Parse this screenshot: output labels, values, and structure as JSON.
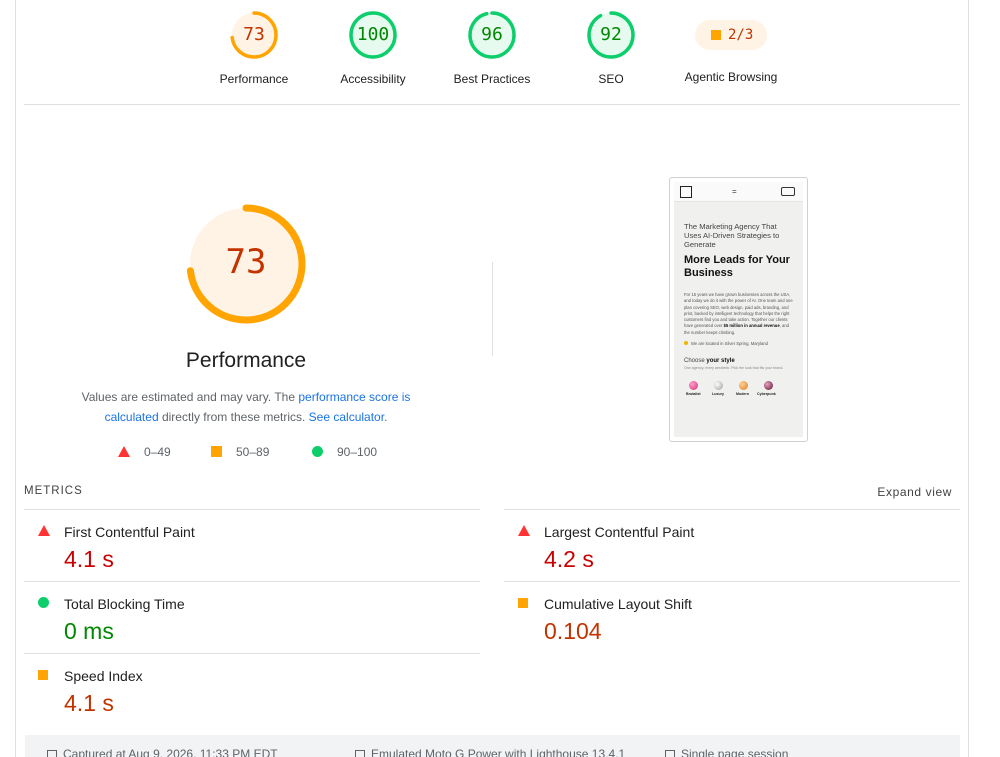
{
  "categories": [
    {
      "name": "Performance",
      "score": "73",
      "level": "average",
      "color": "#ffa400",
      "track": "#fff3e6",
      "fraction": 0.73
    },
    {
      "name": "Accessibility",
      "score": "100",
      "level": "pass",
      "color": "#0cce6b",
      "track": "#e6faef",
      "fraction": 1.0
    },
    {
      "name": "Best Practices",
      "score": "96",
      "level": "pass",
      "color": "#0cce6b",
      "track": "#e6faef",
      "fraction": 0.96
    },
    {
      "name": "SEO",
      "score": "92",
      "level": "pass",
      "color": "#0cce6b",
      "track": "#e6faef",
      "fraction": 0.92
    }
  ],
  "agentic": {
    "label": "Agentic Browsing",
    "value": "2/3"
  },
  "performance": {
    "score": "73",
    "fraction": 0.73,
    "title": "Performance",
    "desc_prefix": "Values are estimated and may vary. The ",
    "desc_link1": "performance score is calculated",
    "desc_mid": " directly from these metrics. ",
    "desc_link2": "See calculator",
    "desc_suffix": "."
  },
  "legend": {
    "fail": "0–49",
    "average": "50–89",
    "pass": "90–100"
  },
  "screenshot": {
    "menu": "=",
    "intro": "The Marketing Agency That Uses AI-Driven Strategies to Generate",
    "headline": "More Leads for Your Business",
    "body_pre": "For 15 years we have grown businesses across the USA, and today we do it with the power of AI. One team and one plan covering SEO, web design, paid ads, branding, and print, backed by intelligent technology that helps the right customers find you and take action. Together our clients have generated over ",
    "body_bold": "$5 million in annual revenue",
    "body_post": ", and the number keeps climbing.",
    "location": "We are located in Silver Spring, Maryland",
    "choose_pre": "Choose ",
    "choose_bold": "your style",
    "choose_sub": "One agency, every aesthetic. Pick the look that fits your brand.",
    "styles": [
      "Brutalist",
      "Luxury",
      "Modern",
      "Cyberpunk"
    ]
  },
  "metrics": {
    "title": "METRICS",
    "expand": "Expand view",
    "items": [
      {
        "name": "First Contentful Paint",
        "value": "4.1 s",
        "level": "fail"
      },
      {
        "name": "Largest Contentful Paint",
        "value": "4.2 s",
        "level": "fail"
      },
      {
        "name": "Total Blocking Time",
        "value": "0 ms",
        "level": "pass"
      },
      {
        "name": "Cumulative Layout Shift",
        "value": "0.104",
        "level": "average"
      },
      {
        "name": "Speed Index",
        "value": "4.1 s",
        "level": "average"
      }
    ]
  },
  "footer": {
    "captured": "Captured at Aug 9, 2026, 11:33 PM EDT",
    "device": "Emulated Moto G Power with Lighthouse 13.4.1",
    "session": "Single page session"
  }
}
